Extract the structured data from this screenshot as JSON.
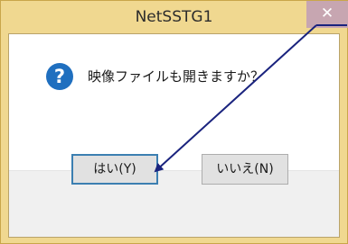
{
  "window": {
    "title": "NetSSTG1",
    "close_glyph": "✕"
  },
  "dialog": {
    "icon": "question-icon",
    "icon_glyph": "?",
    "message": "映像ファイルも開きますか？"
  },
  "buttons": {
    "yes_label": "はい(Y)",
    "no_label": "いいえ(N)"
  },
  "colors": {
    "frame": "#f0d890",
    "close_button": "#c7a6b1",
    "icon": "#1f6fbf",
    "annotation_arrow": "#1a237e",
    "default_button_border": "#3c7fb1"
  }
}
